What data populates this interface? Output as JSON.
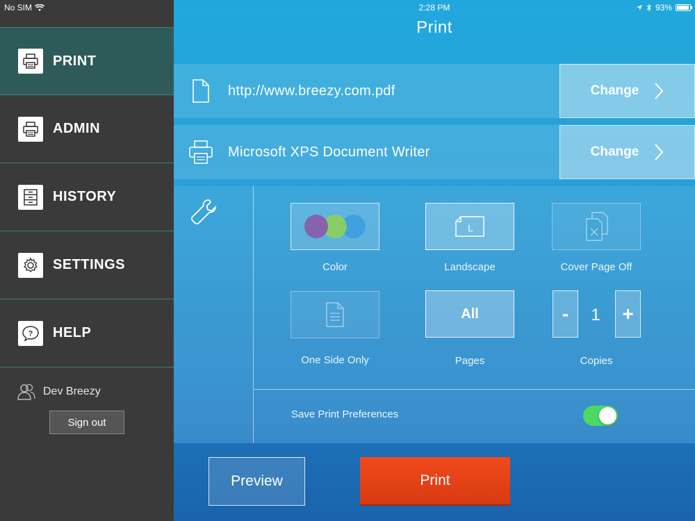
{
  "status": {
    "carrier": "No SIM",
    "time": "2:28 PM",
    "battery": "93%"
  },
  "sidebar": {
    "items": [
      {
        "label": "PRINT",
        "icon": "printer-icon",
        "active": true
      },
      {
        "label": "ADMIN",
        "icon": "printer-icon"
      },
      {
        "label": "HISTORY",
        "icon": "cabinet-icon"
      },
      {
        "label": "SETTINGS",
        "icon": "gear-icon"
      },
      {
        "label": "HELP",
        "icon": "question-bubble-icon"
      }
    ],
    "user_name": "Dev Breezy",
    "sign_out_label": "Sign out"
  },
  "main": {
    "title": "Print",
    "document": {
      "name": "http://www.breezy.com.pdf",
      "change_label": "Change"
    },
    "printer": {
      "name": "Microsoft XPS Document Writer",
      "change_label": "Change"
    },
    "options": {
      "color_label": "Color",
      "orientation_label": "Landscape",
      "orientation_glyph": "L",
      "cover_page_label": "Cover Page Off",
      "sides_label": "One Side Only",
      "pages_value": "All",
      "pages_label": "Pages",
      "copies_minus": "-",
      "copies_value": "1",
      "copies_plus": "+",
      "copies_label": "Copies"
    },
    "save_prefs_label": "Save Print Preferences",
    "save_prefs_on": true,
    "preview_label": "Preview",
    "print_label": "Print"
  },
  "colors": {
    "toggle_on": "#4cd964",
    "print_button": "#e8441a",
    "swatch_purple": "#8a5aa8",
    "swatch_green": "#8cd05a",
    "swatch_blue": "#3a9ee0"
  }
}
